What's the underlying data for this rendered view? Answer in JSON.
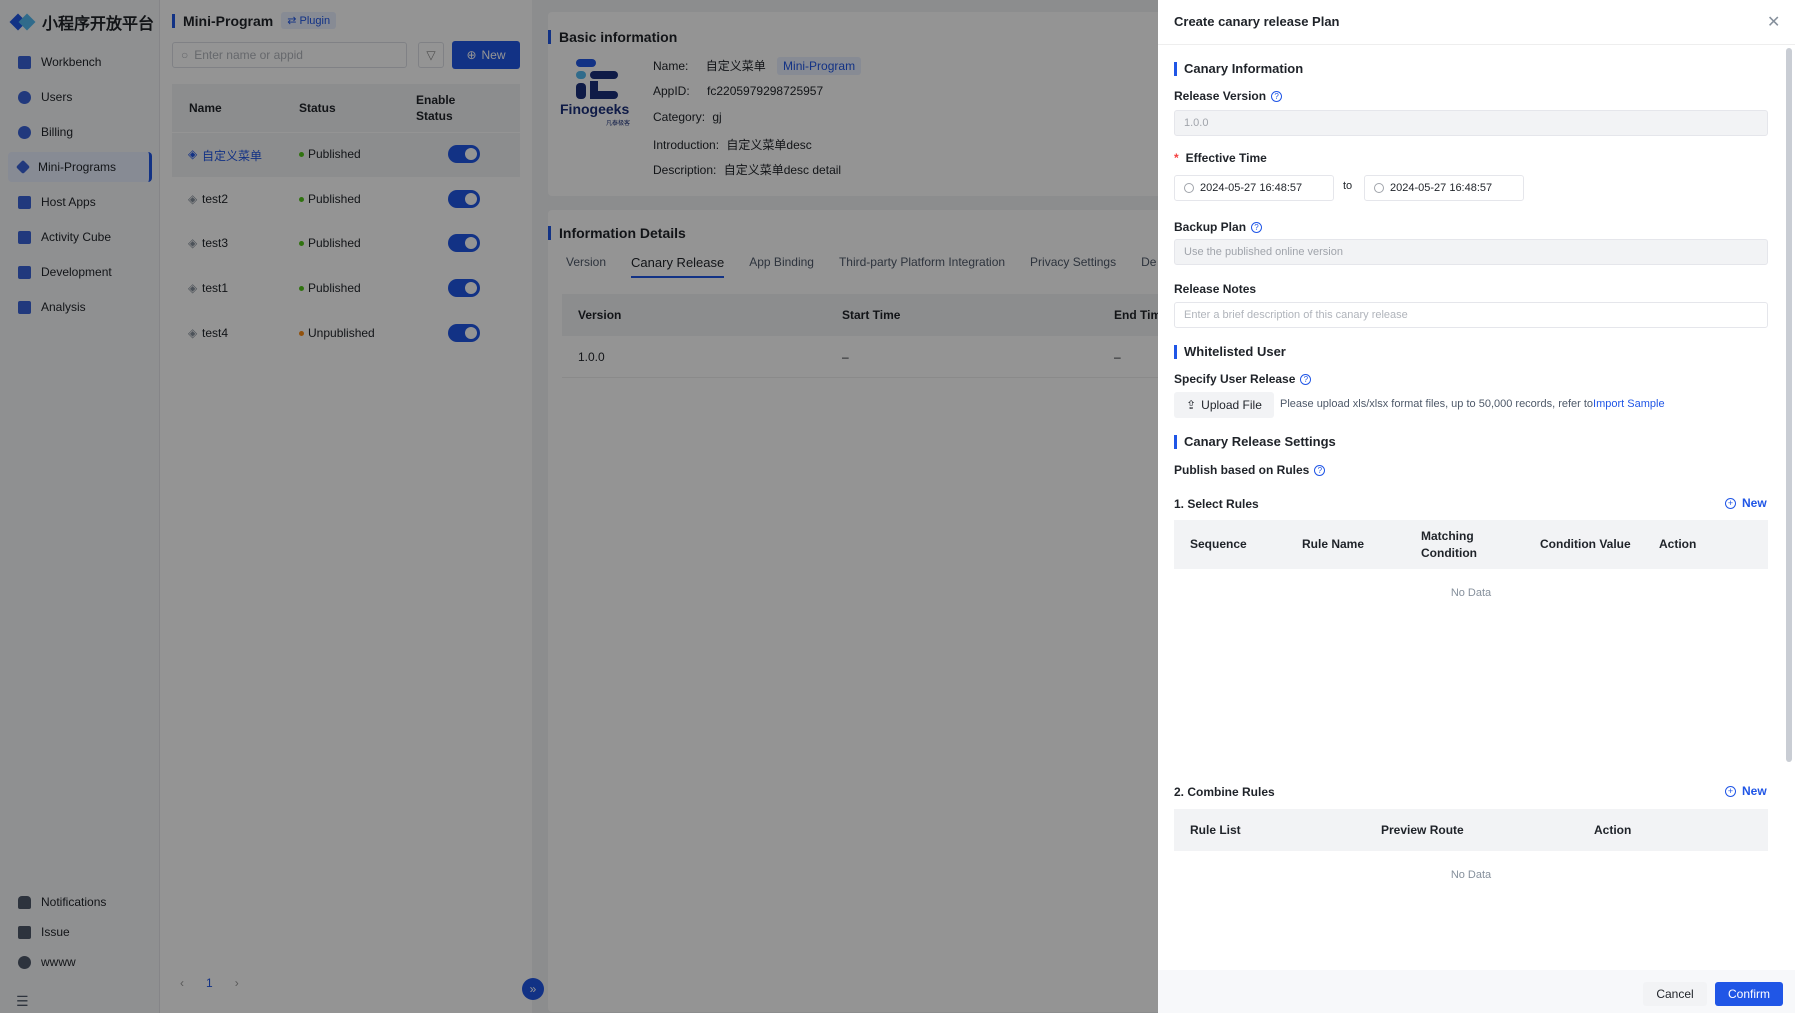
{
  "app": {
    "logo_text": "小程序开放平台",
    "colors": {
      "primary": "#2056e6",
      "published": "#52c41a",
      "unpublished": "#fa8c16"
    }
  },
  "sidebar": {
    "items": [
      {
        "label": "Workbench",
        "icon": "home-icon"
      },
      {
        "label": "Users",
        "icon": "user-icon"
      },
      {
        "label": "Billing",
        "icon": "billing-icon"
      },
      {
        "label": "Mini-Programs",
        "icon": "mini-program-icon",
        "active": true
      },
      {
        "label": "Host Apps",
        "icon": "grid-icon"
      },
      {
        "label": "Activity Cube",
        "icon": "cube-icon"
      },
      {
        "label": "Development",
        "icon": "terminal-icon"
      },
      {
        "label": "Analysis",
        "icon": "chart-icon"
      }
    ],
    "bottom": [
      {
        "label": "Notifications",
        "icon": "bell-icon"
      },
      {
        "label": "Issue",
        "icon": "clipboard-icon"
      },
      {
        "label": "wwww",
        "icon": "user-icon"
      }
    ]
  },
  "list_pane": {
    "title": "Mini-Program",
    "plugin_label": "Plugin",
    "search_placeholder": "Enter name or appid",
    "new_label": "New",
    "columns": {
      "name": "Name",
      "status": "Status",
      "enable": "Enable Status"
    },
    "rows": [
      {
        "name": "自定义菜单",
        "status": "Published",
        "enabled": true
      },
      {
        "name": "test2",
        "status": "Published",
        "enabled": true
      },
      {
        "name": "test3",
        "status": "Published",
        "enabled": true
      },
      {
        "name": "test1",
        "status": "Published",
        "enabled": true
      },
      {
        "name": "test4",
        "status": "Unpublished",
        "enabled": true
      }
    ],
    "page": "1"
  },
  "detail": {
    "basic_title": "Basic information",
    "brand_text": "Finogeeks",
    "brand_sub": "凡泰极客",
    "name_label": "Name:",
    "name_value": "自定义菜单",
    "type_tag": "Mini-Program",
    "appid_label": "AppID:",
    "appid_value": "fc2205979298725957",
    "category_label": "Category:",
    "category_value": "gj",
    "intro_label": "Introduction:",
    "intro_value": "自定义菜单desc",
    "desc_label": "Description:",
    "desc_value": "自定义菜单desc detail",
    "info_title": "Information Details",
    "tabs": [
      "Version",
      "Canary Release",
      "App Binding",
      "Third-party Platform Integration",
      "Privacy Settings",
      "De"
    ],
    "table_headers": [
      "Version",
      "Start Time",
      "End Tim"
    ],
    "table_row": [
      "1.0.0",
      "–",
      "–"
    ]
  },
  "drawer": {
    "title": "Create canary release Plan",
    "canary_info_title": "Canary Information",
    "release_version_label": "Release Version",
    "release_version_value": "1.0.0",
    "effective_time_label": "Effective Time",
    "start_date": "2024-05-27 16:48:57",
    "to_label": "to",
    "end_date": "2024-05-27 16:48:57",
    "backup_plan_label": "Backup Plan",
    "backup_plan_value": "Use the published online version",
    "release_notes_label": "Release Notes",
    "release_notes_placeholder": "Enter  a brief description of this canary release",
    "whitelist_title": "Whitelisted User",
    "specify_user_label": "Specify User Release",
    "upload_label": "Upload File",
    "upload_hint": "Please upload xls/xlsx format files, up to 50,000 records, refer to",
    "import_sample": "Import Sample",
    "settings_title": "Canary Release Settings",
    "publish_rules_label": "Publish based on Rules",
    "select_rules_label": "1. Select Rules",
    "new_label": "New",
    "select_rules_columns": [
      "Sequence",
      "Rule Name",
      "Matching Condition",
      "Condition Value",
      "Action"
    ],
    "no_data": "No Data",
    "combine_rules_label": "2. Combine Rules",
    "combine_rules_columns": [
      "Rule List",
      "Preview Route",
      "Action"
    ],
    "cancel_label": "Cancel",
    "confirm_label": "Confirm"
  }
}
